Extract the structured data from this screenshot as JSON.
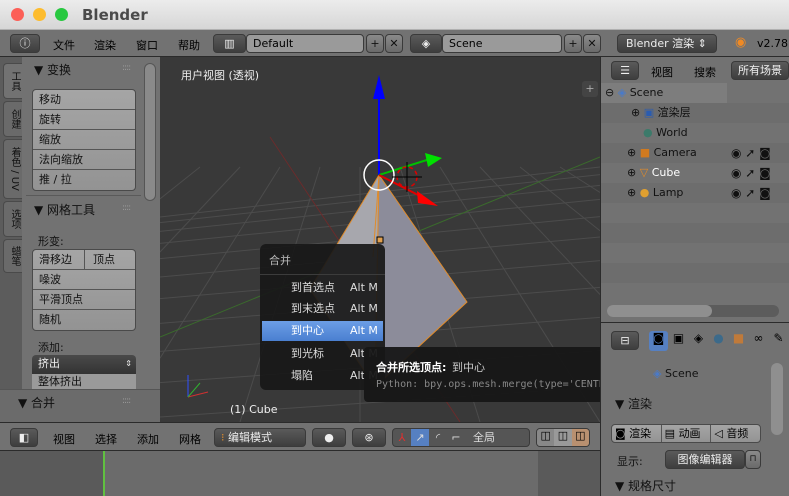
{
  "window": {
    "title": "Blender"
  },
  "topbar": {
    "menus": [
      "文件",
      "渲染",
      "窗口",
      "帮助"
    ],
    "layout": "Default",
    "scene": "Scene",
    "engine": "Blender 渲染",
    "version": "v2.78"
  },
  "tool_tabs": [
    "工具",
    "创建",
    "着色 / UV",
    "选项",
    "蜡笔"
  ],
  "tool_shelf": {
    "transform_title": "变换",
    "transform_items": [
      "移动",
      "旋转",
      "缩放",
      "法向缩放",
      "推 / 拉"
    ],
    "mesh_tools_title": "网格工具",
    "deform_label": "形变:",
    "slide_edge": "滑移边",
    "vertex": "顶点",
    "deform_items": [
      "噪波",
      "平滑顶点",
      "随机"
    ],
    "add_label": "添加:",
    "extrude": "挤出",
    "extrude_region": "整体挤出",
    "merge_title": "合并"
  },
  "viewport": {
    "view_label": "用户视图 (透视)",
    "object_label": "(1) Cube"
  },
  "merge_menu": {
    "title": "合并",
    "items": [
      {
        "label": "到首选点",
        "shortcut": "Alt M"
      },
      {
        "label": "到末选点",
        "shortcut": "Alt M"
      },
      {
        "label": "到中心",
        "shortcut": "Alt M"
      },
      {
        "label": "到光标",
        "shortcut": "Alt M"
      },
      {
        "label": "塌陷",
        "shortcut": "Alt M"
      }
    ],
    "highlighted": 2
  },
  "tooltip": {
    "title": "合并所选顶点:",
    "value": "到中心",
    "python": "Python: bpy.ops.mesh.merge(type='CENTER')"
  },
  "outliner": {
    "menus": [
      "视图",
      "搜索"
    ],
    "filter": "所有场景",
    "items": [
      "Scene",
      "渲染层",
      "World",
      "Camera",
      "Cube",
      "Lamp"
    ]
  },
  "properties": {
    "scene": "Scene",
    "render_title": "渲染",
    "render_btn": "渲染",
    "anim_btn": "动画",
    "audio_btn": "音频",
    "display_label": "显示:",
    "display_value": "图像编辑器",
    "dimensions_title": "规格尺寸"
  },
  "header3d": {
    "menus": [
      "视图",
      "选择",
      "添加",
      "网格"
    ],
    "mode": "编辑模式",
    "orientation": "全局"
  },
  "colors": {
    "accent": "#5680c2",
    "header": "#727272",
    "viewport": "#393939"
  }
}
